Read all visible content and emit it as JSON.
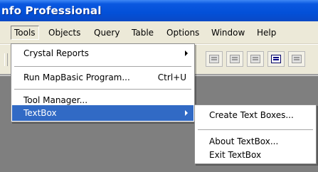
{
  "window": {
    "title": "nfo Professional"
  },
  "menubar": {
    "items": [
      "Tools",
      "Objects",
      "Query",
      "Table",
      "Options",
      "Window",
      "Help"
    ]
  },
  "tools_menu": {
    "items": [
      {
        "label": "Crystal Reports",
        "shortcut": "",
        "submenu": true
      },
      {
        "label": "Run MapBasic Program...",
        "shortcut": "Ctrl+U",
        "submenu": false
      },
      {
        "label": "Tool Manager...",
        "shortcut": "",
        "submenu": false
      },
      {
        "label": "TextBox",
        "shortcut": "",
        "submenu": true
      }
    ]
  },
  "textbox_submenu": {
    "items": [
      {
        "label": "Create Text Boxes..."
      },
      {
        "label": "About TextBox..."
      },
      {
        "label": "Exit TextBox"
      }
    ]
  },
  "colors": {
    "title_bar": "#0350d8",
    "highlight": "#316ac5",
    "menu_bg": "#ffffff",
    "workspace": "#7f7f7f"
  },
  "icons": [
    "toolbar-grid-icon",
    "toolbar-table-icon",
    "toolbar-browser-icon",
    "toolbar-layout-icon",
    "toolbar-legend-icon"
  ]
}
